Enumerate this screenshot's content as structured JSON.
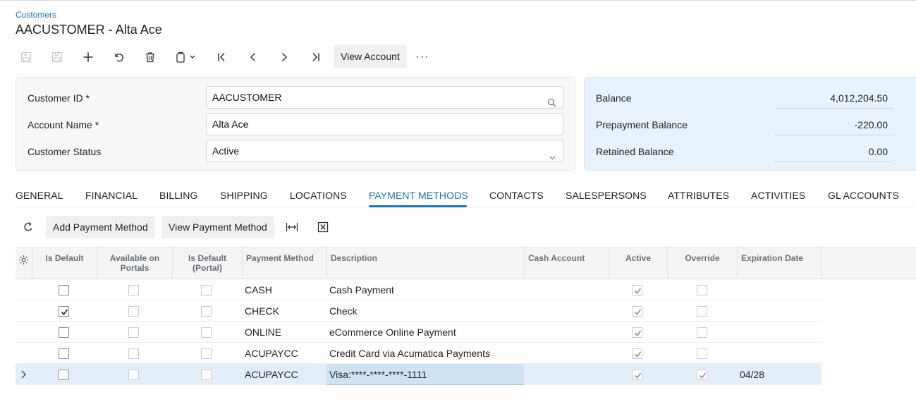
{
  "breadcrumb": "Customers",
  "title": "AACUSTOMER - Alta Ace",
  "toolbar": {
    "icons": [
      "save-close-icon",
      "save-icon",
      "add-icon",
      "undo-icon",
      "delete-icon",
      "copy-paste-icon",
      "first-record-icon",
      "previous-record-icon",
      "next-record-icon",
      "last-record-icon"
    ],
    "view_account_label": "View Account",
    "more_label": "···"
  },
  "form": {
    "customer_id_label": "Customer ID *",
    "customer_id_value": "AACUSTOMER",
    "account_name_label": "Account Name *",
    "account_name_value": "Alta Ace",
    "customer_status_label": "Customer Status",
    "customer_status_value": "Active"
  },
  "balances": {
    "balance_label": "Balance",
    "balance_value": "4,012,204.50",
    "prepayment_label": "Prepayment Balance",
    "prepayment_value": "-220.00",
    "retained_label": "Retained Balance",
    "retained_value": "0.00"
  },
  "tabs": [
    "GENERAL",
    "FINANCIAL",
    "BILLING",
    "SHIPPING",
    "LOCATIONS",
    "PAYMENT METHODS",
    "CONTACTS",
    "SALESPERSONS",
    "ATTRIBUTES",
    "ACTIVITIES",
    "GL ACCOUNTS"
  ],
  "active_tab": "PAYMENT METHODS",
  "grid_toolbar": {
    "add_label": "Add Payment Method",
    "view_label": "View Payment Method"
  },
  "grid": {
    "headers": {
      "is_default": "Is Default",
      "available_on_portals_1": "Available on",
      "available_on_portals_2": "Portals",
      "is_default_portal_1": "Is Default",
      "is_default_portal_2": "(Portal)",
      "payment_method": "Payment Method",
      "description": "Description",
      "cash_account": "Cash Account",
      "active": "Active",
      "override": "Override",
      "expiration_date": "Expiration Date"
    },
    "rows": [
      {
        "is_default": false,
        "available": false,
        "default_portal": false,
        "payment_method": "CASH",
        "description": "Cash Payment",
        "cash_account": "",
        "active": true,
        "override": false,
        "expiration": ""
      },
      {
        "is_default": true,
        "available": false,
        "default_portal": false,
        "payment_method": "CHECK",
        "description": "Check",
        "cash_account": "",
        "active": true,
        "override": false,
        "expiration": ""
      },
      {
        "is_default": false,
        "available": false,
        "default_portal": false,
        "payment_method": "ONLINE",
        "description": "eCommerce Online Payment",
        "cash_account": "",
        "active": true,
        "override": false,
        "expiration": ""
      },
      {
        "is_default": false,
        "available": false,
        "default_portal": false,
        "payment_method": "ACUPAYCC",
        "description": "Credit Card via Acumatica Payments",
        "cash_account": "",
        "active": true,
        "override": false,
        "expiration": ""
      },
      {
        "is_default": false,
        "available": false,
        "default_portal": false,
        "payment_method": "ACUPAYCC",
        "description": "Visa:****-****-****-1111",
        "cash_account": "",
        "active": true,
        "override": true,
        "expiration": "04/28"
      }
    ],
    "selected_row": 4
  }
}
